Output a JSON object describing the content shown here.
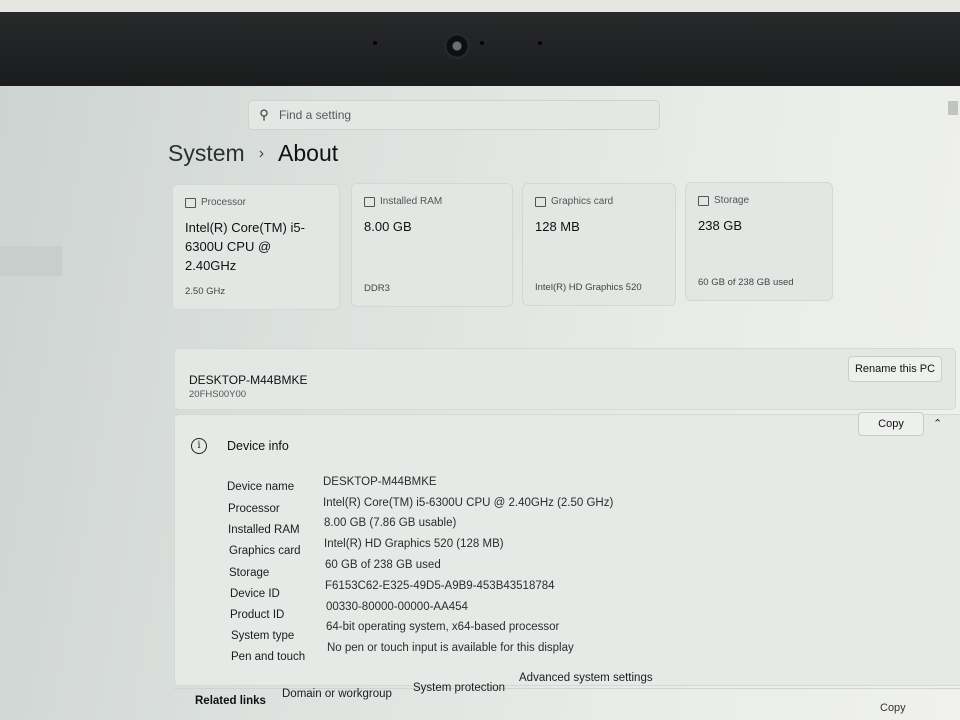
{
  "search": {
    "placeholder": "Find a setting"
  },
  "breadcrumb": {
    "parent": "System",
    "current": "About"
  },
  "cards": [
    {
      "label": "Processor",
      "value": "Intel(R) Core(TM) i5-6300U CPU @ 2.40GHz",
      "sub": "2.50 GHz"
    },
    {
      "label": "Installed RAM",
      "value": "8.00 GB",
      "sub": "DDR3"
    },
    {
      "label": "Graphics card",
      "value": "128 MB",
      "sub": "Intel(R) HD Graphics 520"
    },
    {
      "label": "Storage",
      "value": "238 GB",
      "sub": "60 GB of 238 GB used"
    }
  ],
  "pc": {
    "name": "DESKTOP-M44BMKE",
    "model": "20FHS00Y00",
    "rename_label": "Rename this PC"
  },
  "device_info": {
    "title": "Device info",
    "copy_label": "Copy",
    "specs": [
      {
        "label": "Device name",
        "value": "DESKTOP-M44BMKE"
      },
      {
        "label": "Processor",
        "value": "Intel(R) Core(TM) i5-6300U CPU @ 2.40GHz (2.50 GHz)"
      },
      {
        "label": "Installed RAM",
        "value": "8.00 GB (7.86 GB usable)"
      },
      {
        "label": "Graphics card",
        "value": "Intel(R) HD Graphics 520 (128 MB)"
      },
      {
        "label": "Storage",
        "value": "60 GB of 238 GB used"
      },
      {
        "label": "Device ID",
        "value": "F6153C62-E325-49D5-A9B9-453B43518784"
      },
      {
        "label": "Product ID",
        "value": "00330-80000-00000-AA454"
      },
      {
        "label": "System type",
        "value": "64-bit operating system, x64-based processor"
      },
      {
        "label": "Pen and touch",
        "value": "No pen or touch input is available for this display"
      }
    ]
  },
  "related": {
    "label": "Related links",
    "links": [
      "Domain or workgroup",
      "System protection",
      "Advanced system settings"
    ]
  },
  "windows_spec": {
    "copy_label": "Copy"
  }
}
